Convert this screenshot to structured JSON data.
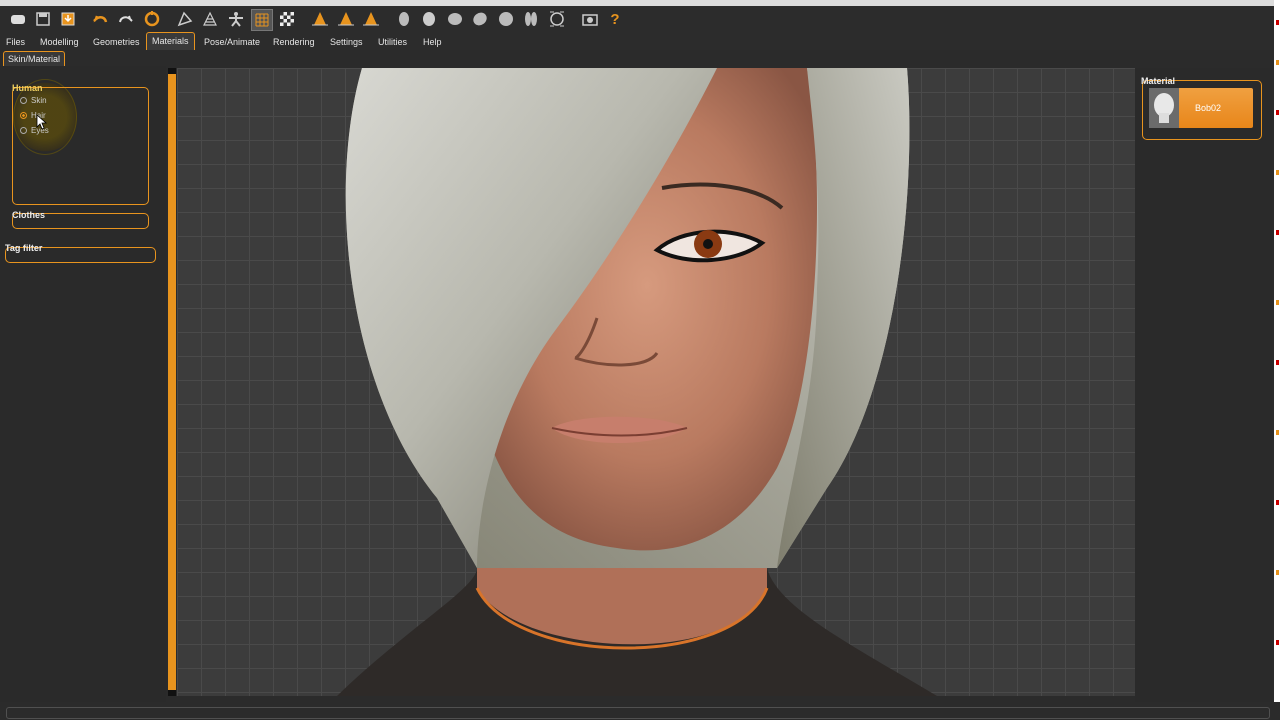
{
  "menu": [
    "Files",
    "Modelling",
    "Geometries",
    "Materials",
    "Pose/Animate",
    "Rendering",
    "Settings",
    "Utilities",
    "Help"
  ],
  "active_tab": "Materials",
  "subtab": "Skin/Material",
  "human_group": {
    "title": "Human",
    "options": [
      "Skin",
      "Hair",
      "Eyes"
    ],
    "selected": "Hair"
  },
  "clothes_title": "Clothes",
  "tag_filter_title": "Tag filter",
  "material_panel": {
    "title": "Material",
    "item": "Bob02"
  },
  "accent_color": "#e8941e",
  "toolbar_icons": [
    "new-file-icon",
    "save-icon",
    "export-icon",
    "undo-icon",
    "redo-icon",
    "reset-icon",
    "smooth-icon",
    "wireframe-icon",
    "pose-icon",
    "grid-icon",
    "checker-icon",
    "front-view-icon",
    "side-view-icon",
    "top-view-icon",
    "head-view-icon",
    "body-view-icon",
    "rotate-view-icon",
    "reset-view-icon",
    "symmetry-icon",
    "frame-icon",
    "screenshot-icon",
    "help-icon"
  ]
}
